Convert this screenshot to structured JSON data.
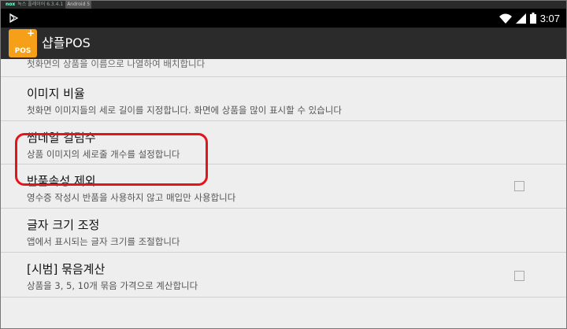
{
  "emulator": {
    "brand": "nox",
    "title": "녹스 플레이어 6.3.4.1",
    "android_tag": "Android 5"
  },
  "status_bar": {
    "time": "3:07"
  },
  "app_bar": {
    "icon_text": "POS",
    "title": "샵플POS"
  },
  "partial_item": {
    "summary": "첫화면의 상품을 이름으로 나열하여 배치합니다"
  },
  "items": [
    {
      "title": "이미지 비율",
      "summary": "첫화면 이미지들의 세로 길이를 지정합니다. 화면에 상품을 많이 표시할 수 있습니다"
    },
    {
      "title": "썸네일 컬럼수",
      "summary": "상품 이미지의 세로줄 개수를 설정합니다"
    },
    {
      "title": "반품속성 제외",
      "summary": "영수증 작성시 반품을 사용하지 않고 매입만 사용합니다",
      "checked": false
    },
    {
      "title": "글자 크기 조정",
      "summary": "앱에서 표시되는 글자 크기를 조절합니다"
    },
    {
      "title": "[시범] 묶음계산",
      "summary": "상품을 3, 5, 10개 묶음 가격으로 계산합니다",
      "checked": false
    }
  ]
}
